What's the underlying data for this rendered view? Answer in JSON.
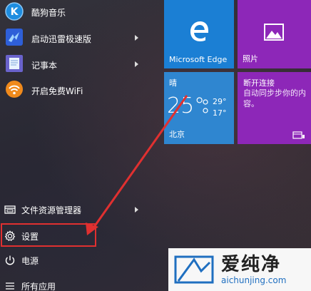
{
  "apps": [
    {
      "label": "酷狗音乐",
      "icon": "kugou-icon",
      "color": "#1e8de0",
      "has_submenu": false
    },
    {
      "label": "启动迅雷极速版",
      "icon": "xunlei-icon",
      "color": "#3a6fe0",
      "has_submenu": true
    },
    {
      "label": "记事本",
      "icon": "notepad-icon",
      "color": "#6b6ed0",
      "has_submenu": true
    },
    {
      "label": "开启免费WiFi",
      "icon": "wifi-icon",
      "color": "#f08a1c",
      "has_submenu": false
    }
  ],
  "system": {
    "file_explorer": "文件资源管理器",
    "settings": "设置",
    "power": "电源",
    "all_apps": "所有应用"
  },
  "tiles": {
    "edge": {
      "label": "Microsoft Edge",
      "color": "#1b7fd4"
    },
    "photos": {
      "label": "照片",
      "color": "#8d27b8"
    },
    "weather": {
      "condition": "晴",
      "temp": "25°",
      "high": "29°",
      "low": "17°",
      "city": "北京",
      "color": "#2f86d0"
    },
    "store": {
      "title": "断开连接",
      "message": "自动同步步你的内容。",
      "color": "#8d27b8"
    }
  },
  "watermark": {
    "brand_cn": "爱纯净",
    "brand_url": "aichunjing.com"
  },
  "annotation": {
    "highlight_color": "#e03030"
  }
}
